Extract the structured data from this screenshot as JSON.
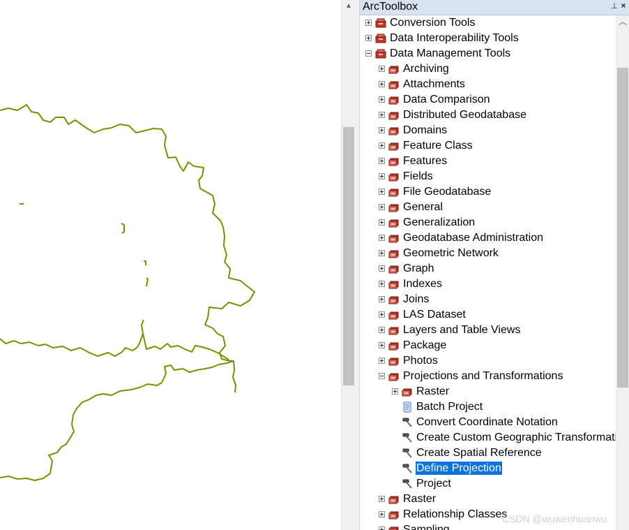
{
  "panel": {
    "title": "ArcToolbox",
    "pin_glyph": "⊥",
    "close_glyph": "×",
    "scroll_up_glyph": "︿"
  },
  "tree": [
    {
      "label": "Conversion Tools",
      "level": 0,
      "icon": "toolbox-icon",
      "expander": "plus"
    },
    {
      "label": "Data Interoperability Tools",
      "level": 0,
      "icon": "toolbox-icon",
      "expander": "plus"
    },
    {
      "label": "Data Management Tools",
      "level": 0,
      "icon": "toolbox-icon",
      "expander": "minus"
    },
    {
      "label": "Archiving",
      "level": 1,
      "icon": "toolset-icon",
      "expander": "plus"
    },
    {
      "label": "Attachments",
      "level": 1,
      "icon": "toolset-icon",
      "expander": "plus"
    },
    {
      "label": "Data Comparison",
      "level": 1,
      "icon": "toolset-icon",
      "expander": "plus"
    },
    {
      "label": "Distributed Geodatabase",
      "level": 1,
      "icon": "toolset-icon",
      "expander": "plus"
    },
    {
      "label": "Domains",
      "level": 1,
      "icon": "toolset-icon",
      "expander": "plus"
    },
    {
      "label": "Feature Class",
      "level": 1,
      "icon": "toolset-icon",
      "expander": "plus"
    },
    {
      "label": "Features",
      "level": 1,
      "icon": "toolset-icon",
      "expander": "plus"
    },
    {
      "label": "Fields",
      "level": 1,
      "icon": "toolset-icon",
      "expander": "plus"
    },
    {
      "label": "File Geodatabase",
      "level": 1,
      "icon": "toolset-icon",
      "expander": "plus"
    },
    {
      "label": "General",
      "level": 1,
      "icon": "toolset-icon",
      "expander": "plus"
    },
    {
      "label": "Generalization",
      "level": 1,
      "icon": "toolset-icon",
      "expander": "plus"
    },
    {
      "label": "Geodatabase Administration",
      "level": 1,
      "icon": "toolset-icon",
      "expander": "plus"
    },
    {
      "label": "Geometric Network",
      "level": 1,
      "icon": "toolset-icon",
      "expander": "plus"
    },
    {
      "label": "Graph",
      "level": 1,
      "icon": "toolset-icon",
      "expander": "plus"
    },
    {
      "label": "Indexes",
      "level": 1,
      "icon": "toolset-icon",
      "expander": "plus"
    },
    {
      "label": "Joins",
      "level": 1,
      "icon": "toolset-icon",
      "expander": "plus"
    },
    {
      "label": "LAS Dataset",
      "level": 1,
      "icon": "toolset-icon",
      "expander": "plus"
    },
    {
      "label": "Layers and Table Views",
      "level": 1,
      "icon": "toolset-icon",
      "expander": "plus"
    },
    {
      "label": "Package",
      "level": 1,
      "icon": "toolset-icon",
      "expander": "plus"
    },
    {
      "label": "Photos",
      "level": 1,
      "icon": "toolset-icon",
      "expander": "plus"
    },
    {
      "label": "Projections and Transformations",
      "level": 1,
      "icon": "toolset-icon",
      "expander": "minus"
    },
    {
      "label": "Raster",
      "level": 2,
      "icon": "toolset-icon",
      "expander": "plus"
    },
    {
      "label": "Batch Project",
      "level": 2,
      "icon": "script-icon",
      "expander": "none"
    },
    {
      "label": "Convert Coordinate Notation",
      "level": 2,
      "icon": "hammer-icon",
      "expander": "none"
    },
    {
      "label": "Create Custom Geographic Transformation",
      "level": 2,
      "icon": "hammer-icon",
      "expander": "none"
    },
    {
      "label": "Create Spatial Reference",
      "level": 2,
      "icon": "hammer-icon",
      "expander": "none"
    },
    {
      "label": "Define Projection",
      "level": 2,
      "icon": "hammer-icon",
      "expander": "none",
      "selected": true
    },
    {
      "label": "Project",
      "level": 2,
      "icon": "hammer-icon",
      "expander": "none"
    },
    {
      "label": "Raster",
      "level": 1,
      "icon": "toolset-icon",
      "expander": "plus"
    },
    {
      "label": "Relationship Classes",
      "level": 1,
      "icon": "toolset-icon",
      "expander": "plus"
    },
    {
      "label": "Sampling",
      "level": 1,
      "icon": "toolset-icon",
      "expander": "plus"
    }
  ],
  "map": {
    "line_color": "#7f8c00",
    "scroll_up_glyph": "▲"
  },
  "watermark": "CSDN @wuwenhuanwu",
  "colors": {
    "selection": "#0a74da",
    "title_bar": "#d8e3f1",
    "toolbox_red": "#c0392b"
  }
}
